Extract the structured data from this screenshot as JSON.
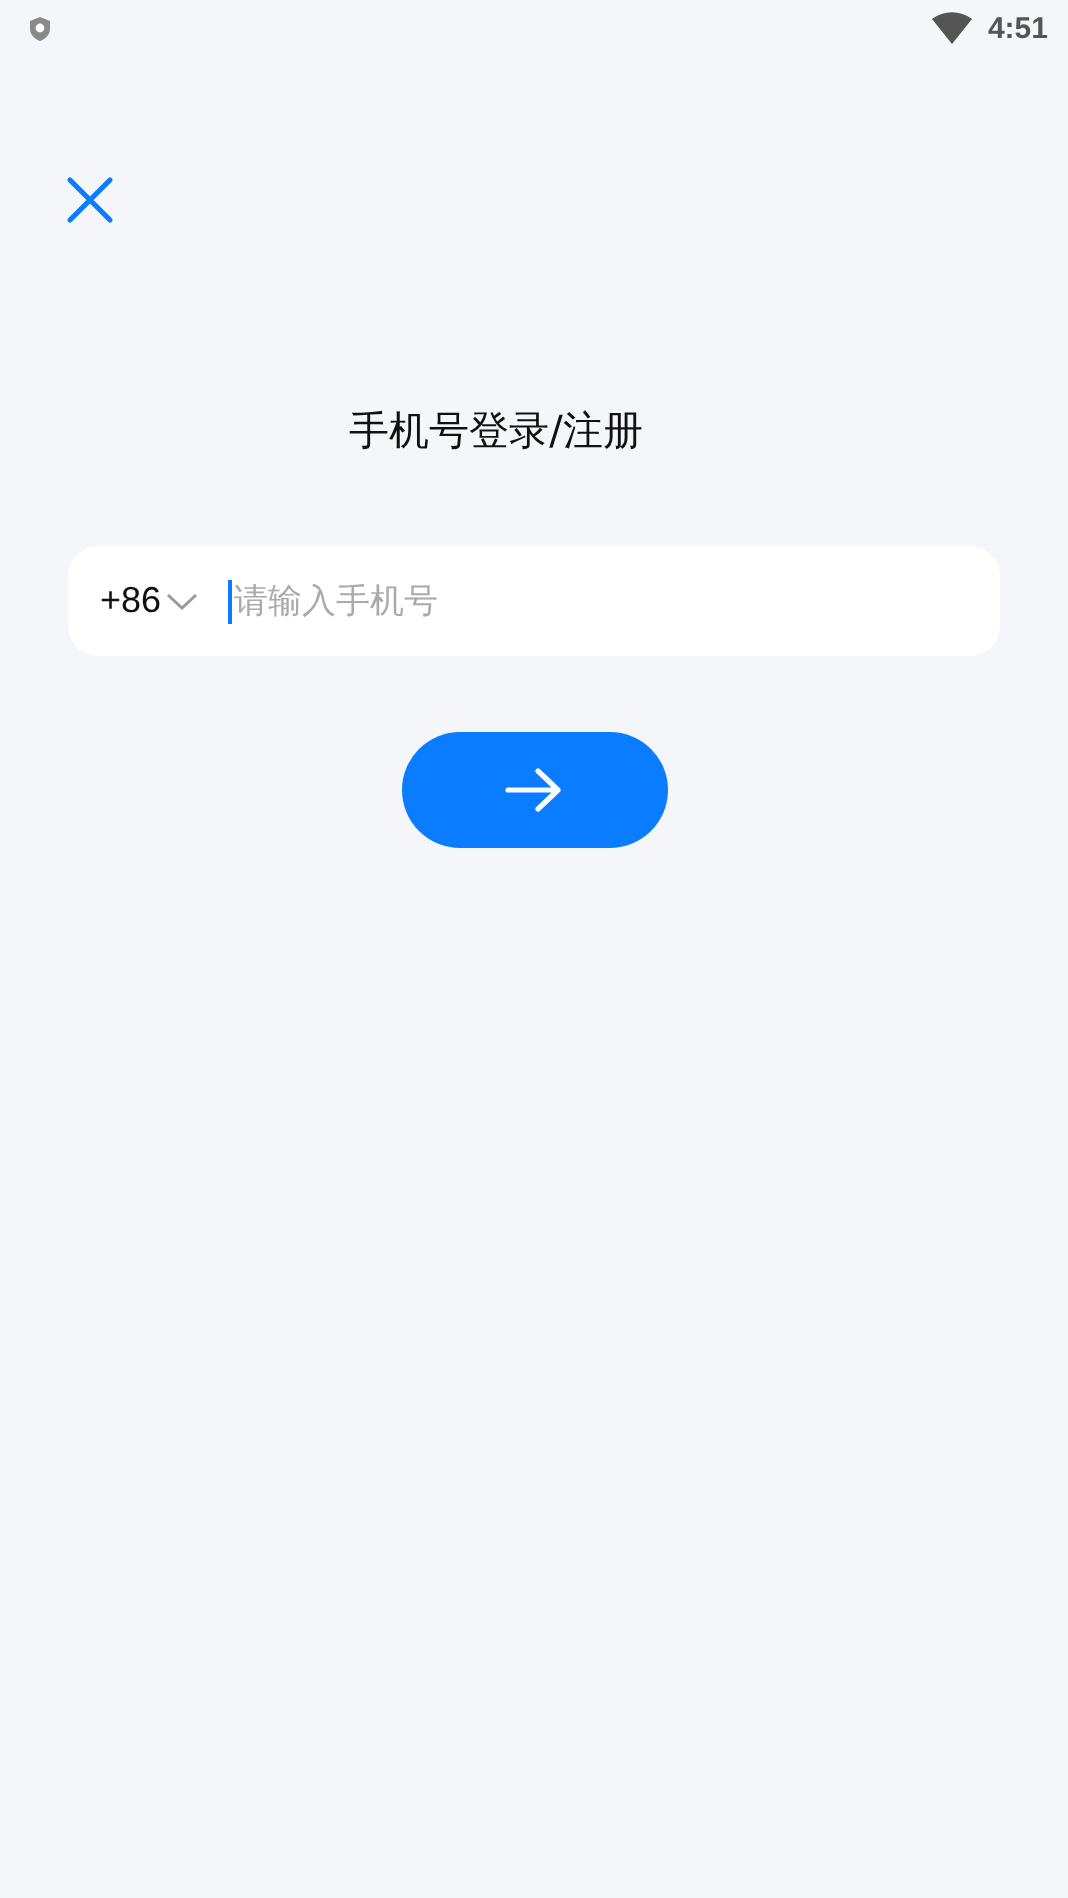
{
  "status_bar": {
    "time": "4:51"
  },
  "title": "手机号登录/注册",
  "phone_field": {
    "country_code": "+86",
    "placeholder": "请输入手机号",
    "focused": true
  },
  "next_button": {
    "enabled": true
  }
}
